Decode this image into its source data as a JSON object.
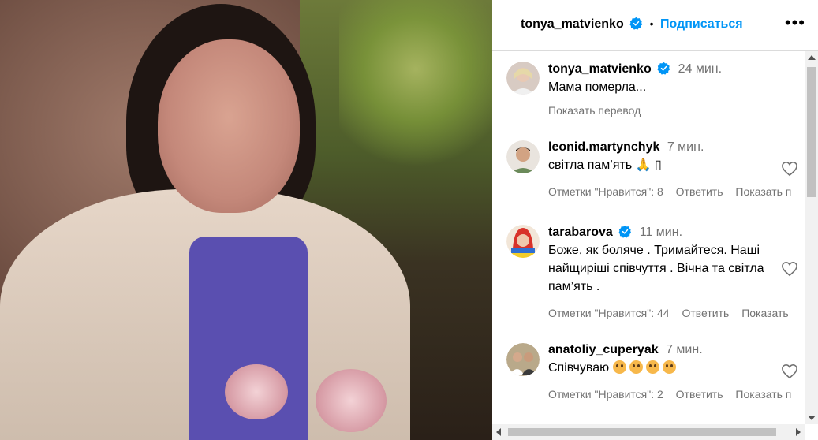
{
  "post": {
    "author": "tonya_matvienko",
    "separator": "•",
    "follow_label": "Подписаться",
    "more_label": "•••"
  },
  "comments": [
    {
      "user": "tonya_matvienko",
      "verified": true,
      "time": "24 мин.",
      "text": "Мама померла...",
      "translate_label": "Показать перевод"
    },
    {
      "user": "leonid.martynchyk",
      "verified": false,
      "time": "7 мин.",
      "text": "світла пам’ять 🙏 ",
      "text_extra": "▯",
      "likes_label": "Отметки \"Нравится\": 8",
      "reply_label": "Ответить",
      "show_label": "Показать п"
    },
    {
      "user": "tarabarova",
      "verified": true,
      "time": "11 мин.",
      "text": "Боже, як боляче . Тримайтеся. Наші найщиріші співчуття . Вічна та світла пам’ять .",
      "likes_label": "Отметки \"Нравится\": 44",
      "reply_label": "Ответить",
      "show_label": "Показать"
    },
    {
      "user": "anatoliy_cuperyak",
      "verified": false,
      "time": "7 мин.",
      "text": "Співчуваю",
      "likes_label": "Отметки \"Нравится\": 2",
      "reply_label": "Ответить",
      "show_label": "Показать п"
    }
  ],
  "icons": {
    "verified": "verified-badge-icon",
    "heart": "heart-outline-icon",
    "more": "more-options-icon"
  },
  "colors": {
    "accent": "#0095f6",
    "secondary_text": "#737373",
    "divider": "#dbdbdb"
  }
}
